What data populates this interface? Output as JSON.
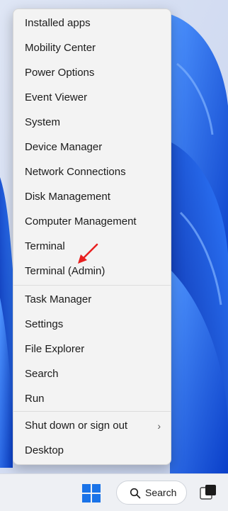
{
  "menu": {
    "items": [
      {
        "label": "Installed apps"
      },
      {
        "label": "Mobility Center"
      },
      {
        "label": "Power Options"
      },
      {
        "label": "Event Viewer"
      },
      {
        "label": "System"
      },
      {
        "label": "Device Manager"
      },
      {
        "label": "Network Connections"
      },
      {
        "label": "Disk Management"
      },
      {
        "label": "Computer Management"
      },
      {
        "label": "Terminal"
      },
      {
        "label": "Terminal (Admin)"
      },
      {
        "label": "Task Manager"
      },
      {
        "label": "Settings"
      },
      {
        "label": "File Explorer"
      },
      {
        "label": "Search"
      },
      {
        "label": "Run"
      },
      {
        "label": "Shut down or sign out"
      },
      {
        "label": "Desktop"
      }
    ],
    "submenu_chevron": "›"
  },
  "annotation": {
    "arrow_color": "#e81f1f",
    "target": "Terminal (Admin)"
  },
  "taskbar": {
    "search_label": "Search",
    "start_icon": "windows-logo-icon",
    "search_icon": "search-icon",
    "taskview_icon": "task-view-icon",
    "accent": "#1a73e8"
  },
  "colors": {
    "wallpaper_primary": "#1e5fe0",
    "wallpaper_light": "#cfd8ee",
    "menu_bg": "#f3f3f3"
  }
}
